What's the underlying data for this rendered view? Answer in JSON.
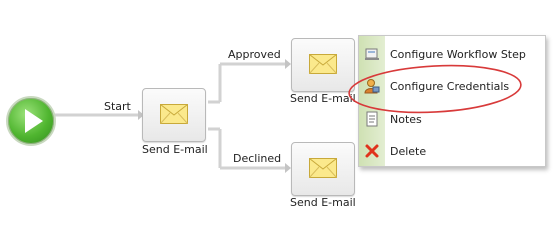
{
  "workflow": {
    "start_label": "Start",
    "approved_label": "Approved",
    "declined_label": "Declined",
    "nodes": [
      {
        "label": "Send E-mail"
      },
      {
        "label": "Send E-mail"
      },
      {
        "label": "Send E-mail"
      }
    ]
  },
  "context_menu": {
    "items": [
      {
        "label": "Configure Workflow Step",
        "icon": "configure-step-icon"
      },
      {
        "label": "Configure Credentials",
        "icon": "credentials-icon"
      },
      {
        "label": "Notes",
        "icon": "notes-icon"
      },
      {
        "label": "Delete",
        "icon": "delete-icon"
      }
    ]
  },
  "colors": {
    "start_green": "#4fb52f",
    "connector": "#d2d2d2",
    "highlight_ellipse": "#d83a3a",
    "envelope_fill": "#fbe98c",
    "delete_red": "#e0331c"
  }
}
